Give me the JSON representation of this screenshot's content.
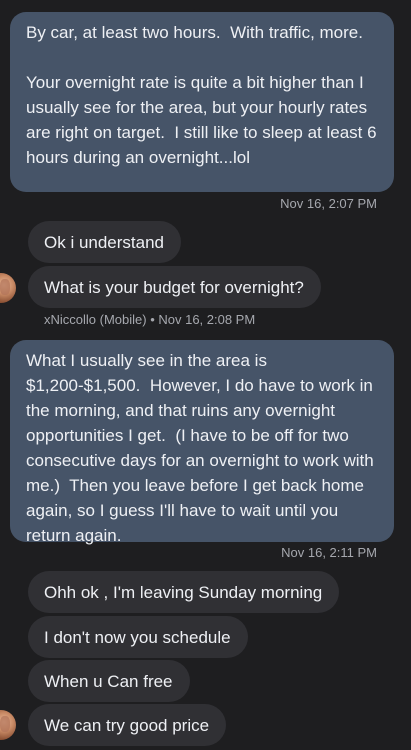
{
  "messages": {
    "m1_text": "By car, at least two hours.  With traffic, more.\n\nYour overnight rate is quite a bit higher than I usually see for the area, but your hourly rates are right on target.  I still like to sleep at least 6 hours during an overnight...lol",
    "m1_time": "Nov 16, 2:07 PM",
    "r1_text": "Ok i understand",
    "r2_text": "What is your budget for overnight?",
    "r_meta": "xNiccollo (Mobile) • Nov 16, 2:08 PM",
    "m2_text": "What I usually see in the area is $1,200-$1,500.  However, I do have to work in the morning, and that ruins any overnight opportunities I get.  (I have to be off for two consecutive days for an overnight to work with me.)  Then you leave before I get back home again, so I guess I'll have to wait until you return again.",
    "m2_time": "Nov 16, 2:11 PM",
    "r3_text": "Ohh ok , I'm leaving Sunday morning",
    "r4_text": "I don't now you schedule",
    "r5_text": "When u Can free",
    "r6_text": "We can try good price"
  },
  "colors": {
    "background": "#1e1e20",
    "sent_bubble": "#465468",
    "received_bubble": "#303034",
    "meta_text": "#a6a8ae"
  }
}
